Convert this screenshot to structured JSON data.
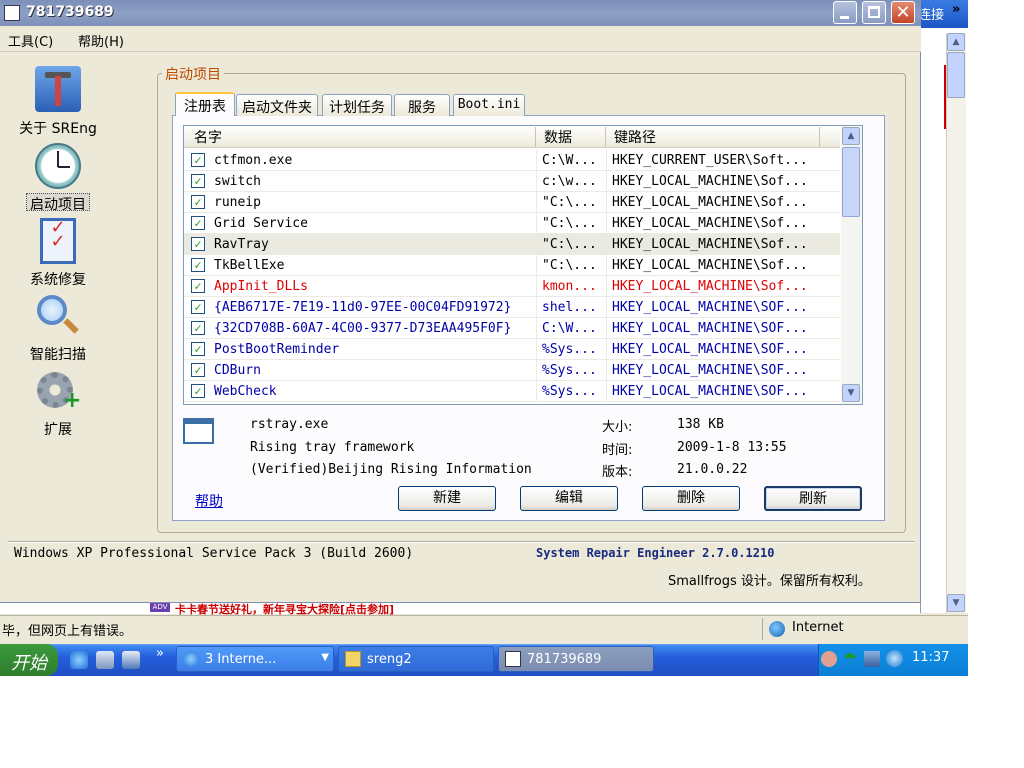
{
  "background_browser": {
    "title_link": "连接",
    "chevron": "»",
    "ad_text": "卡卡春节送好礼，新年寻宝大探险[点击参加]",
    "ad_icon": "ADV",
    "status_text": "毕，但网页上有错误。",
    "zone": "Internet"
  },
  "taskbar": {
    "start_label": "开始",
    "quicklaunch_more": "»",
    "tasks": [
      {
        "label": "3 Interne...",
        "icon": "ie-icon"
      },
      {
        "label": "sreng2",
        "icon": "folder-icon"
      },
      {
        "label": "781739689",
        "icon": "sreng-app-icon"
      }
    ],
    "clock": "11:37"
  },
  "window": {
    "title": "781739689",
    "menu": [
      "工具(C)",
      "帮助(H)"
    ],
    "sidebar": [
      {
        "label": "关于 SREng",
        "icon": "tools-icon"
      },
      {
        "label": "启动项目",
        "icon": "clock-icon"
      },
      {
        "label": "系统修复",
        "icon": "checklist-icon"
      },
      {
        "label": "智能扫描",
        "icon": "magnifier-icon"
      },
      {
        "label": "扩展",
        "icon": "gear-plus-icon"
      }
    ],
    "group_title": "启动项目",
    "tabs": [
      "注册表",
      "启动文件夹",
      "计划任务",
      "服务",
      "Boot.ini"
    ],
    "list": {
      "columns": [
        "名字",
        "数据",
        "键路径"
      ],
      "rows": [
        {
          "name": "ctfmon.exe",
          "data": "C:\\W...",
          "key": "HKEY_CURRENT_USER\\Soft...",
          "color": "black"
        },
        {
          "name": "switch",
          "data": "c:\\w...",
          "key": "HKEY_LOCAL_MACHINE\\Sof...",
          "color": "black"
        },
        {
          "name": "runeip",
          "data": "\"C:\\...",
          "key": "HKEY_LOCAL_MACHINE\\Sof...",
          "color": "black"
        },
        {
          "name": "Grid Service",
          "data": "\"C:\\...",
          "key": "HKEY_LOCAL_MACHINE\\Sof...",
          "color": "black"
        },
        {
          "name": "RavTray",
          "data": "\"C:\\...",
          "key": "HKEY_LOCAL_MACHINE\\Sof...",
          "color": "black"
        },
        {
          "name": "TkBellExe",
          "data": "\"C:\\...",
          "key": "HKEY_LOCAL_MACHINE\\Sof...",
          "color": "black"
        },
        {
          "name": "AppInit_DLLs",
          "data": "kmon...",
          "key": "HKEY_LOCAL_MACHINE\\Sof...",
          "color": "red"
        },
        {
          "name": "{AEB6717E-7E19-11d0-97EE-00C04FD91972}",
          "data": "shel...",
          "key": "HKEY_LOCAL_MACHINE\\SOF...",
          "color": "blue"
        },
        {
          "name": "{32CD708B-60A7-4C00-9377-D73EAA495F0F}",
          "data": "C:\\W...",
          "key": "HKEY_LOCAL_MACHINE\\SOF...",
          "color": "blue"
        },
        {
          "name": "PostBootReminder",
          "data": "%Sys...",
          "key": "HKEY_LOCAL_MACHINE\\SOF...",
          "color": "blue"
        },
        {
          "name": "CDBurn",
          "data": "%Sys...",
          "key": "HKEY_LOCAL_MACHINE\\SOF...",
          "color": "blue"
        },
        {
          "name": "WebCheck",
          "data": "%Sys...",
          "key": "HKEY_LOCAL_MACHINE\\SOF...",
          "color": "blue"
        }
      ]
    },
    "detail": {
      "file": "rstray.exe",
      "desc": "Rising tray framework",
      "company": "(Verified)Beijing Rising Information",
      "size_label": "大小:",
      "size": "138 KB",
      "time_label": "时间:",
      "time": "2009-1-8 13:55",
      "version_label": "版本:",
      "version": "21.0.0.22"
    },
    "help_link": "帮助",
    "buttons": [
      "新建",
      "编辑",
      "删除",
      "刷新"
    ],
    "os_info": "Windows XP Professional Service Pack 3 (Build 2600)",
    "product": "System Repair Engineer 2.7.0.1210",
    "copyright": "Smallfrogs 设计。保留所有权利。"
  },
  "colors": {
    "red_entry": "#e00000",
    "blue_entry": "#0000a8",
    "group_title": "#c14a00",
    "title_bar": "#7b8fb8"
  }
}
